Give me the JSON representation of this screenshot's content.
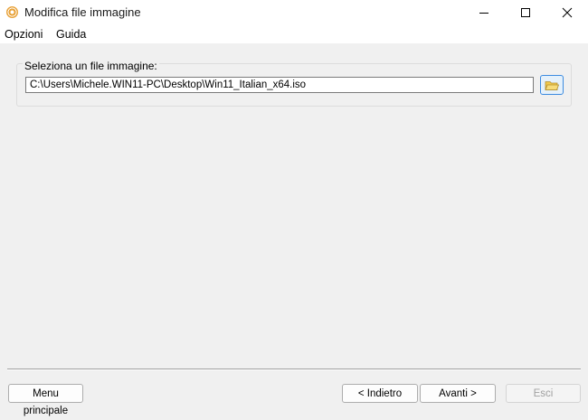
{
  "window": {
    "title": "Modifica file immagine",
    "icon": "disc-icon",
    "controls": [
      "minimize-icon",
      "maximize-icon",
      "close-icon"
    ]
  },
  "menubar": {
    "items": [
      {
        "label": "Opzioni"
      },
      {
        "label": "Guida"
      }
    ]
  },
  "image_group": {
    "label": "Seleziona un file immagine:",
    "path_value": "C:\\Users\\Michele.WIN11-PC\\Desktop\\Win11_Italian_x64.iso",
    "browse_icon": "folder-icon"
  },
  "footer": {
    "home_label": "Menu principale",
    "back_label": "< Indietro",
    "next_label": "Avanti >",
    "exit_label": "Esci"
  },
  "colors": {
    "accent": "#3c8be0",
    "icon_orange": "#e8a33b",
    "folder_yellow": "#f2c94c"
  }
}
